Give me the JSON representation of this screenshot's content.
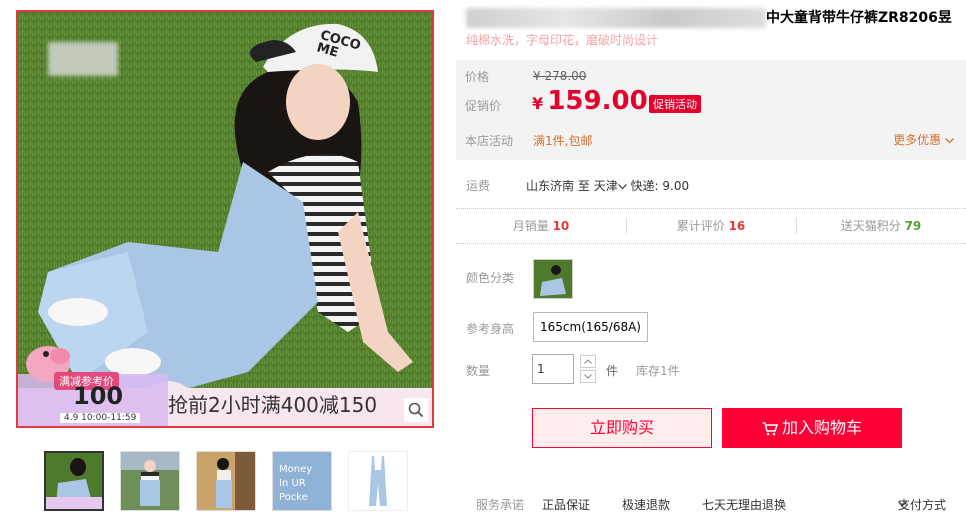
{
  "product": {
    "title_visible": "中大童背带牛仔裤ZR8206昱",
    "subtitle": "纯棉水洗，字母印花，磨破时尚设计"
  },
  "gallery": {
    "cap_text": "COCO\nME",
    "promo": {
      "badge": "满减参考价",
      "price": "100",
      "date": "4.9 10:00-11:59",
      "text": "抢前2小时满400减150"
    },
    "thumbnails": [
      {
        "name": "thumb-1",
        "label": ""
      },
      {
        "name": "thumb-2",
        "label": ""
      },
      {
        "name": "thumb-3",
        "label": ""
      },
      {
        "name": "thumb-4",
        "label": "Money In UR Pocket"
      },
      {
        "name": "thumb-5",
        "label": ""
      }
    ]
  },
  "price": {
    "label_price": "价格",
    "original": "¥ 278.00",
    "label_promo": "促销价",
    "currency": "¥",
    "current": "159.00",
    "tag": "促销活动",
    "label_activity": "本店活动",
    "activity": "满1件,包邮",
    "more_offers": "更多优惠"
  },
  "shipping": {
    "label": "运费",
    "from": "山东济南",
    "to_word": "至",
    "to": "天津",
    "express": "快递: 9.00"
  },
  "stats": {
    "monthly_label": "月销量",
    "monthly": "10",
    "reviews_label": "累计评价",
    "reviews": "16",
    "points_label": "送天猫积分",
    "points": "79"
  },
  "options": {
    "color_label": "颜色分类",
    "size_label": "参考身高",
    "size_value": "165cm(165/68A)",
    "qty_label": "数量",
    "qty_value": "1",
    "qty_unit": "件",
    "stock": "库存1件"
  },
  "actions": {
    "buy_now": "立即购买",
    "add_cart": "加入购物车"
  },
  "service": {
    "label": "服务承诺",
    "items": [
      "正品保证",
      "极速退款",
      "七天无理由退换"
    ],
    "pay": "支付方式"
  },
  "colors": {
    "accent": "#ff0036",
    "price_red": "#e4002b",
    "orange": "#d4712f"
  }
}
